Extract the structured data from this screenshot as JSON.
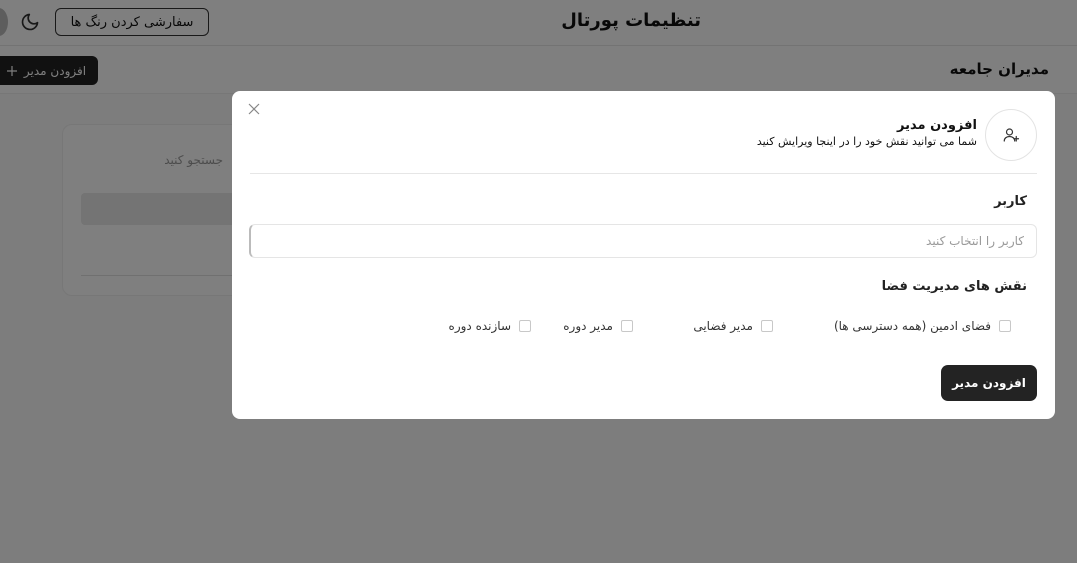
{
  "header": {
    "title": "تنظیمات پورتال",
    "customize_colors_label": "سفارشی کردن رنگ ها"
  },
  "subheader": {
    "title": "مدیران جامعه",
    "add_admin_label": "افزودن مدیر"
  },
  "background_card": {
    "search_placeholder": "جستجو کنید"
  },
  "modal": {
    "title": "افزودن مدیر",
    "subtitle": "شما می توانید نقش خود را در اینجا ویرایش کنید",
    "user_label": "کاربر",
    "user_placeholder": "کاربر را انتخاب کنید",
    "roles_label": "نقش های مدیریت فضا",
    "roles": [
      {
        "label": "فضای ادمین (همه دسترسی ها)",
        "checked": false
      },
      {
        "label": "مدیر فضایی",
        "checked": false
      },
      {
        "label": "مدیر دوره",
        "checked": false
      },
      {
        "label": "سازنده دوره",
        "checked": false
      }
    ],
    "submit_label": "افزودن مدیر"
  },
  "colors": {
    "primary_button": "#232323",
    "overlay": "rgba(0,0,0,0.5)"
  }
}
